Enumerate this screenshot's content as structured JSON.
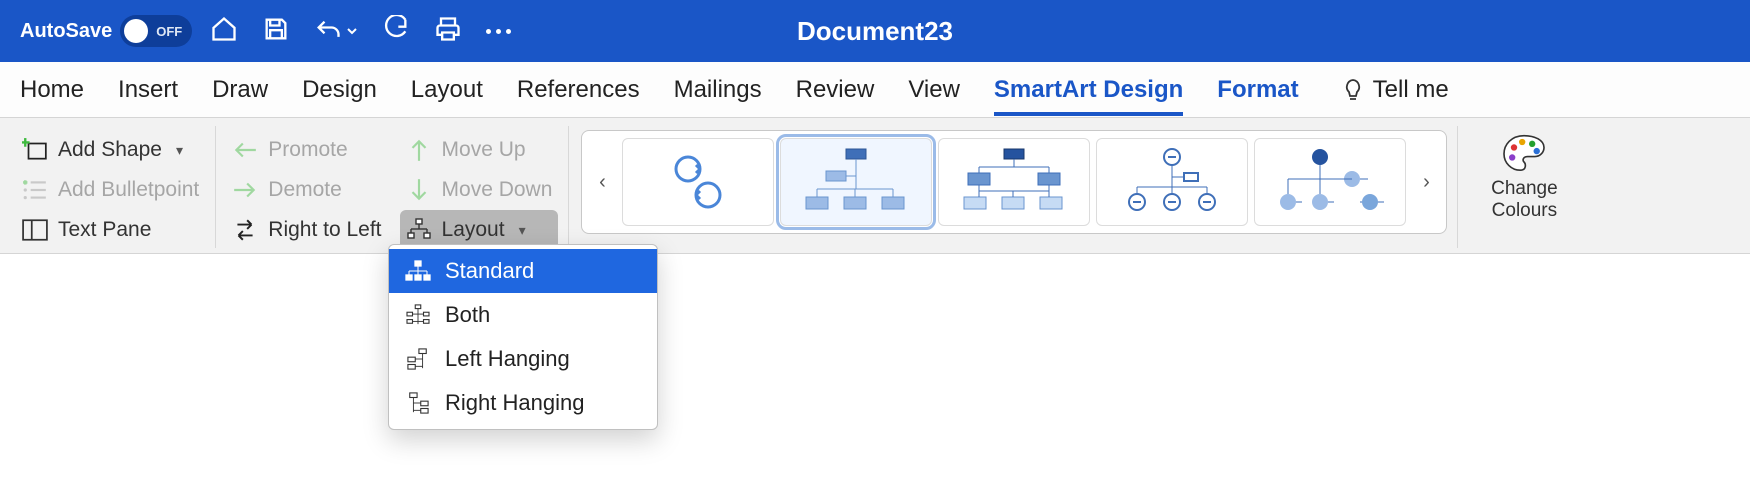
{
  "titlebar": {
    "autosave_label": "AutoSave",
    "autosave_state": "OFF",
    "document_title": "Document23"
  },
  "tabs": [
    {
      "label": "Home",
      "state": "normal"
    },
    {
      "label": "Insert",
      "state": "normal"
    },
    {
      "label": "Draw",
      "state": "normal"
    },
    {
      "label": "Design",
      "state": "normal"
    },
    {
      "label": "Layout",
      "state": "normal"
    },
    {
      "label": "References",
      "state": "normal"
    },
    {
      "label": "Mailings",
      "state": "normal"
    },
    {
      "label": "Review",
      "state": "normal"
    },
    {
      "label": "View",
      "state": "normal"
    },
    {
      "label": "SmartArt Design",
      "state": "active"
    },
    {
      "label": "Format",
      "state": "blue"
    }
  ],
  "tell_me": "Tell me",
  "ribbon": {
    "create": {
      "add_shape": "Add Shape",
      "add_bulletpoint": "Add Bulletpoint",
      "text_pane": "Text Pane"
    },
    "reorg": {
      "promote": "Promote",
      "demote": "Demote",
      "right_to_left": "Right to Left",
      "move_up": "Move Up",
      "move_down": "Move Down",
      "layout": "Layout"
    },
    "layout_menu": {
      "items": [
        {
          "label": "Standard",
          "selected": true
        },
        {
          "label": "Both",
          "selected": false
        },
        {
          "label": "Left Hanging",
          "selected": false
        },
        {
          "label": "Right Hanging",
          "selected": false
        }
      ]
    },
    "layouts_gallery": {
      "items": [
        {
          "name": "cycle",
          "selected": false
        },
        {
          "name": "org-chart-1",
          "selected": true
        },
        {
          "name": "org-chart-2",
          "selected": false
        },
        {
          "name": "org-chart-3",
          "selected": false
        },
        {
          "name": "org-chart-4",
          "selected": false
        }
      ]
    },
    "change_colours": "Change Colours"
  }
}
